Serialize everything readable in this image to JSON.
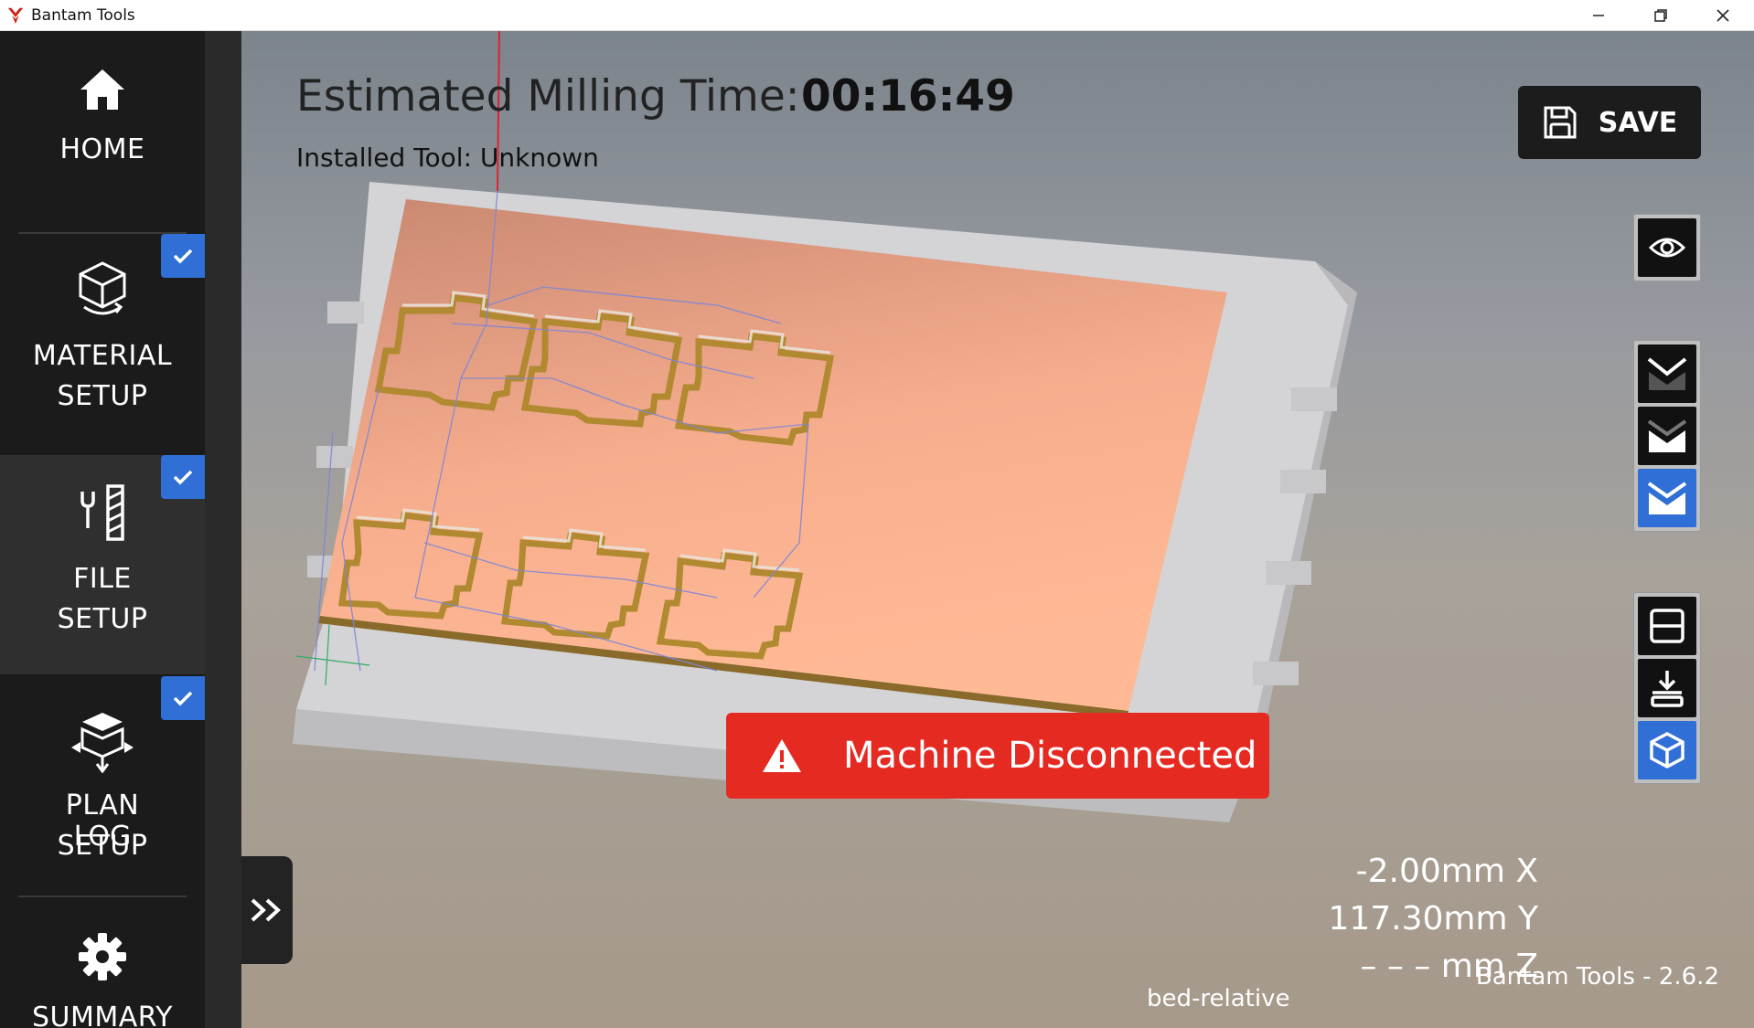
{
  "window": {
    "title": "Bantam Tools",
    "minimize": "—",
    "restore": "❐",
    "close": "✕"
  },
  "sidebar": {
    "items": [
      {
        "label": "HOME",
        "icon": "home-icon",
        "checked": false
      },
      {
        "label": "MATERIAL\nSETUP",
        "icon": "material-cube-icon",
        "checked": true
      },
      {
        "label": "FILE\nSETUP",
        "icon": "tools-icon",
        "checked": true,
        "active": true
      },
      {
        "label": "PLAN\nSETUP",
        "icon": "plan-cube-icon",
        "checked": true
      },
      {
        "label": "SUMMARY",
        "icon": "gear-icon",
        "checked": false
      }
    ],
    "overlap_label": "LOG",
    "check_color": "#2f6fd6"
  },
  "header": {
    "estimate_label": "Estimated Milling Time:",
    "estimate_time": "00:16:49",
    "installed_tool": "Installed Tool: Unknown"
  },
  "toolbar": {
    "save_label": "SAVE",
    "save_icon": "floppy-disk-icon"
  },
  "view_controls": {
    "visibility": "eye-icon",
    "depth_views": [
      "depth-view-1-icon",
      "depth-view-2-icon",
      "depth-view-3-icon"
    ],
    "camera_views": [
      "top-view-icon",
      "load-position-icon",
      "iso-cube-icon"
    ],
    "selected_color": "#2f6fd6"
  },
  "alert": {
    "text": "Machine Disconnected",
    "icon": "warning-icon",
    "color": "#e52a22"
  },
  "position": {
    "x": "-2.00mm X",
    "y": "117.30mm Y",
    "z": "– – – mm Z",
    "mode": "bed-relative"
  },
  "footer": {
    "version": "Bantam Tools - 2.6.2"
  },
  "colors": {
    "copper": "#f1a384",
    "sidebar_bg": "#1b1b1b"
  }
}
